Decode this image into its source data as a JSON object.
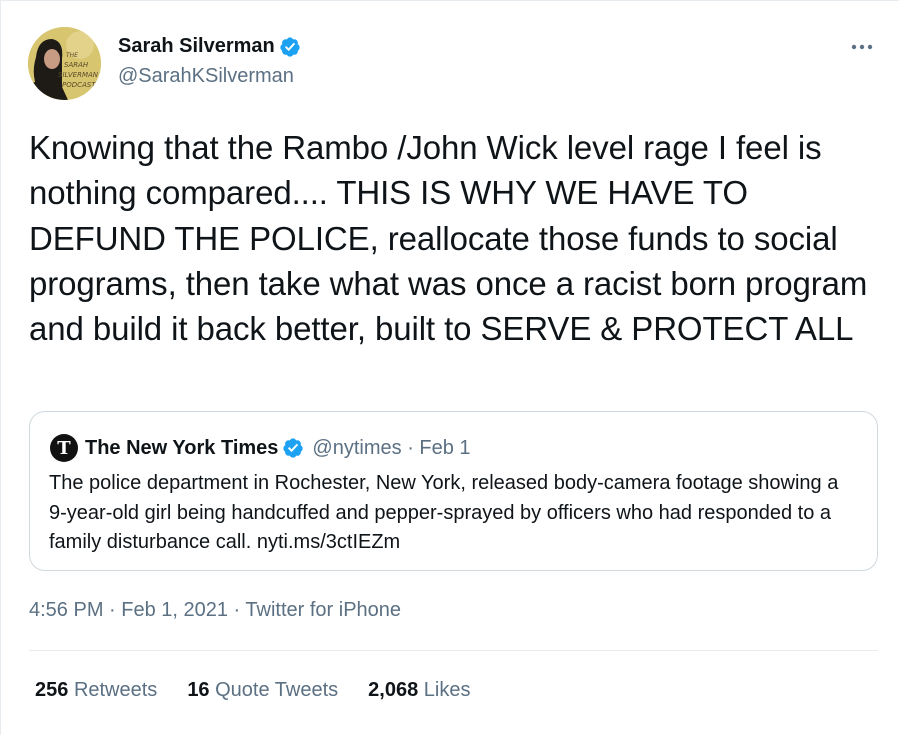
{
  "author": {
    "name": "Sarah Silverman",
    "handle": "@SarahKSilverman",
    "avatar_icon": "podcast-cover-avatar",
    "verified_color": "#1da1f2"
  },
  "tweet": {
    "text": "Knowing that the Rambo /John Wick level rage I feel is nothing compared.... THIS IS WHY WE HAVE TO DEFUND THE POLICE, reallocate those funds to social programs, then take what was once a racist born program and build it back better, built to SERVE & PROTECT ALL",
    "timestamp": "4:56 PM · Feb 1, 2021 · Twitter for iPhone"
  },
  "quoted": {
    "name": "The New York Times",
    "logo_glyph": "T",
    "meta": "@nytimes · Feb 1",
    "text": "The police department in Rochester, New York, released body-camera footage showing a 9-year-old girl being handcuffed and pepper-sprayed by officers who had responded to a family disturbance call. nyti.ms/3ctIEZm"
  },
  "stats": [
    {
      "count": "256",
      "label": "Retweets"
    },
    {
      "count": "16",
      "label": "Quote Tweets"
    },
    {
      "count": "2,068",
      "label": "Likes"
    }
  ]
}
